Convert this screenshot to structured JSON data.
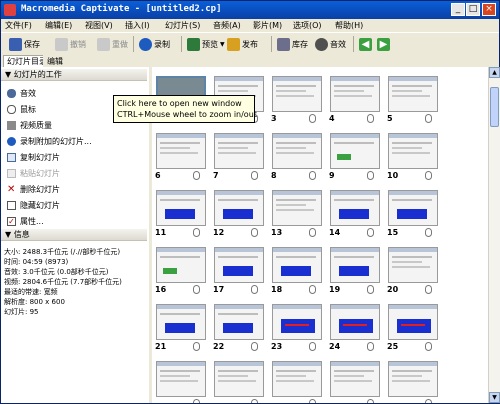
{
  "window": {
    "title": "Macromedia Captivate - [untitled2.cp]",
    "minimize": "_",
    "maximize": "□",
    "close": "×"
  },
  "menu": [
    "文件(F)",
    "编辑(E)",
    "视图(V)",
    "插入(I)",
    "幻灯片(S)",
    "音频(A)",
    "影片(M)",
    "选项(O)",
    "帮助(H)"
  ],
  "toolbar": {
    "save": "保存",
    "undo": "撤销",
    "redo": "重做",
    "record": "录制",
    "preview": "预览",
    "publish": "发布",
    "library": "库存",
    "audio": "音效"
  },
  "tabs": [
    "幻灯片目录",
    "编辑"
  ],
  "left_panel": {
    "tasks_header": "幻灯片的工作",
    "tasks": [
      {
        "label": "音效",
        "disabled": false,
        "icon": "speaker-icon"
      },
      {
        "label": "鼠标",
        "disabled": false,
        "icon": "mouse-icon"
      },
      {
        "label": "视频质量",
        "disabled": false,
        "icon": "camera-icon"
      },
      {
        "label": "录制附加的幻灯片...",
        "disabled": false,
        "icon": "record-icon"
      },
      {
        "label": "复制幻灯片",
        "disabled": false,
        "icon": "copy-icon"
      },
      {
        "label": "粘贴幻灯片",
        "disabled": true,
        "icon": "paste-icon"
      },
      {
        "label": "删除幻灯片",
        "disabled": false,
        "icon": "delete-x-icon"
      },
      {
        "label": "隐藏幻灯片",
        "disabled": false,
        "icon": "hide-icon"
      },
      {
        "label": "属性...",
        "disabled": false,
        "icon": "properties-icon"
      }
    ],
    "info_header": "信息",
    "info_lines": [
      "大小: 2488.3千位元 (/.//部秒千位元)",
      "时间: 04:59 (8973)",
      "音效: 3.0千位元 (0.0部秒千位元)",
      "视频: 2804.6千位元 (7.7部秒千位元)",
      "最适的带速: 宽频",
      "解析度: 800 x 600",
      "幻灯片: 95"
    ]
  },
  "tooltip": {
    "line1": "Click here to open new window",
    "line2": "CTRL+Mouse wheel to zoom in/out"
  },
  "slides": [
    {
      "num": "",
      "kind": "selected"
    },
    {
      "num": "2",
      "kind": "plain"
    },
    {
      "num": "3",
      "kind": "plain"
    },
    {
      "num": "4",
      "kind": "plain"
    },
    {
      "num": "5",
      "kind": "plain"
    },
    {
      "num": "6",
      "kind": "plain"
    },
    {
      "num": "7",
      "kind": "plain"
    },
    {
      "num": "8",
      "kind": "plain"
    },
    {
      "num": "9",
      "kind": "green"
    },
    {
      "num": "10",
      "kind": "plain"
    },
    {
      "num": "11",
      "kind": "blue"
    },
    {
      "num": "12",
      "kind": "blue"
    },
    {
      "num": "13",
      "kind": "plain"
    },
    {
      "num": "14",
      "kind": "blue"
    },
    {
      "num": "15",
      "kind": "blue"
    },
    {
      "num": "16",
      "kind": "green"
    },
    {
      "num": "17",
      "kind": "blue"
    },
    {
      "num": "18",
      "kind": "blue"
    },
    {
      "num": "19",
      "kind": "blue"
    },
    {
      "num": "20",
      "kind": "plain"
    },
    {
      "num": "21",
      "kind": "blue"
    },
    {
      "num": "22",
      "kind": "blue"
    },
    {
      "num": "23",
      "kind": "red"
    },
    {
      "num": "24",
      "kind": "red"
    },
    {
      "num": "25",
      "kind": "red"
    },
    {
      "num": "",
      "kind": "plain"
    },
    {
      "num": "",
      "kind": "plain"
    },
    {
      "num": "",
      "kind": "plain"
    },
    {
      "num": "",
      "kind": "plain"
    },
    {
      "num": "",
      "kind": "plain"
    }
  ]
}
